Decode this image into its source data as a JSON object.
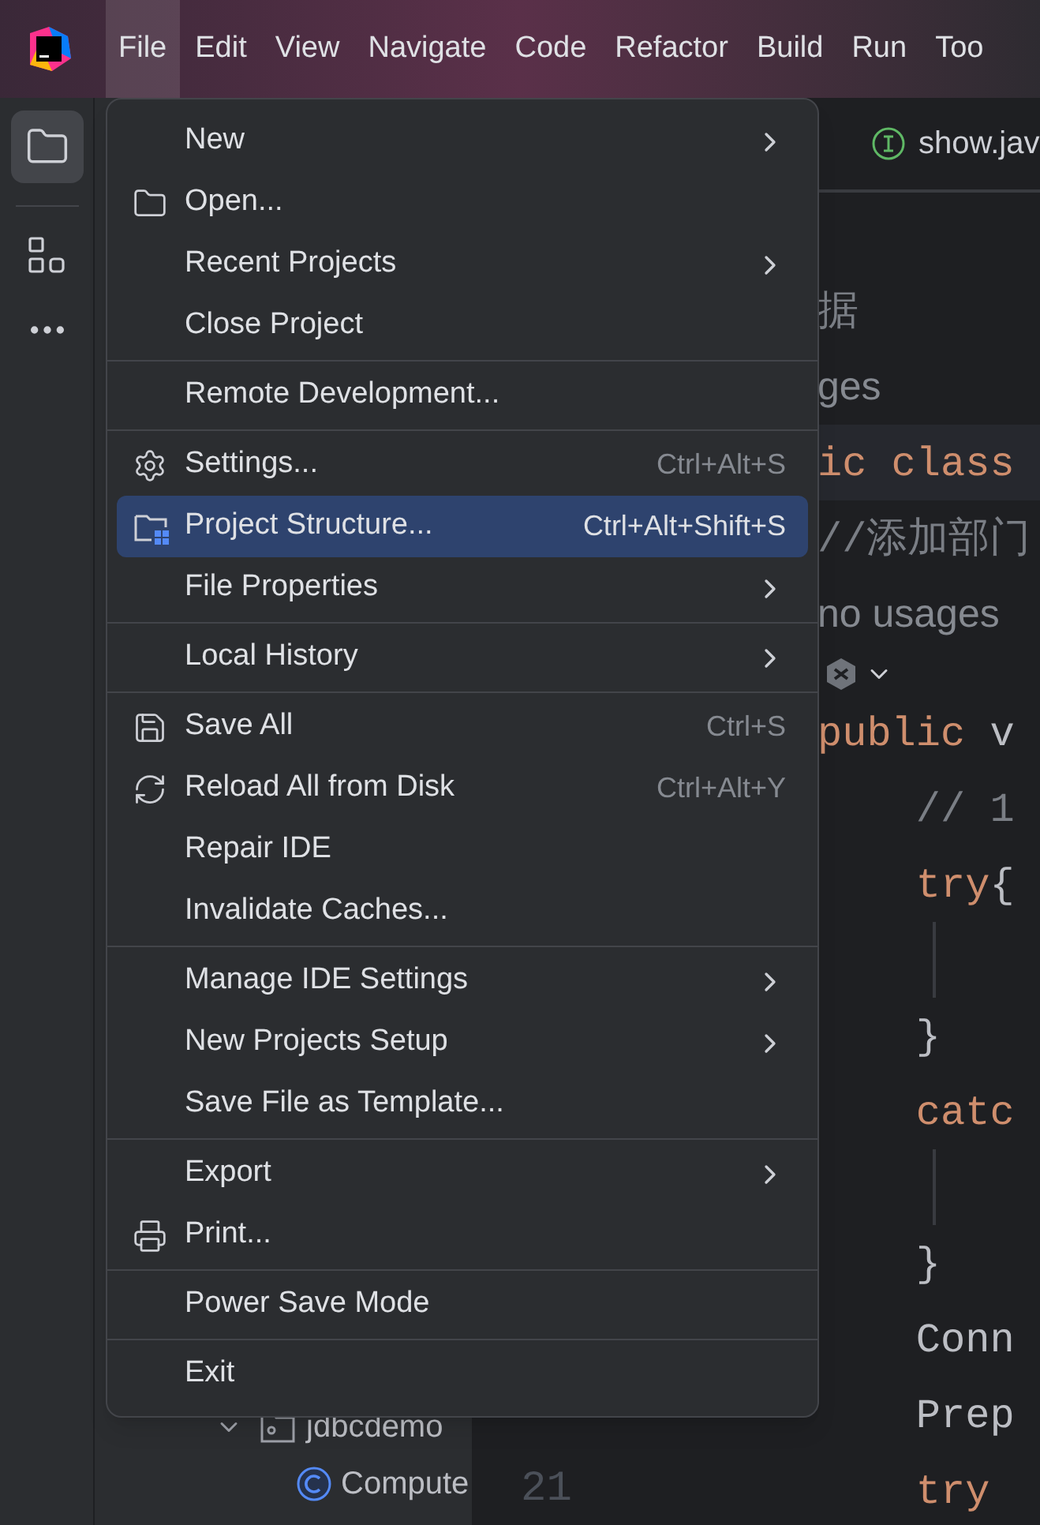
{
  "menubar": [
    {
      "label": "File",
      "selected": true
    },
    {
      "label": "Edit",
      "selected": false
    },
    {
      "label": "View",
      "selected": false
    },
    {
      "label": "Navigate",
      "selected": false
    },
    {
      "label": "Code",
      "selected": false
    },
    {
      "label": "Refactor",
      "selected": false
    },
    {
      "label": "Build",
      "selected": false
    },
    {
      "label": "Run",
      "selected": false
    },
    {
      "label": "Too",
      "selected": false
    }
  ],
  "file_menu": {
    "sections": [
      [
        {
          "label": "New",
          "submenu": true,
          "selected": false
        },
        {
          "label": "Open...",
          "submenu": false,
          "selected": false
        },
        {
          "label": "Recent Projects",
          "submenu": true,
          "selected": false
        },
        {
          "label": "Close Project",
          "submenu": false,
          "selected": false
        }
      ],
      [
        {
          "label": "Remote Development...",
          "submenu": false,
          "selected": false
        }
      ],
      [
        {
          "label": "Settings...",
          "shortcut": "Ctrl+Alt+S",
          "submenu": false,
          "selected": false
        },
        {
          "label": "Project Structure...",
          "shortcut": "Ctrl+Alt+Shift+S",
          "submenu": false,
          "selected": true
        },
        {
          "label": "File Properties",
          "submenu": true,
          "selected": false
        }
      ],
      [
        {
          "label": "Local History",
          "submenu": true,
          "selected": false
        }
      ],
      [
        {
          "label": "Save All",
          "shortcut": "Ctrl+S",
          "submenu": false,
          "selected": false
        },
        {
          "label": "Reload All from Disk",
          "shortcut": "Ctrl+Alt+Y",
          "submenu": false,
          "selected": false
        },
        {
          "label": "Repair IDE",
          "submenu": false,
          "selected": false
        },
        {
          "label": "Invalidate Caches...",
          "submenu": false,
          "selected": false
        }
      ],
      [
        {
          "label": "Manage IDE Settings",
          "submenu": true,
          "selected": false
        },
        {
          "label": "New Projects Setup",
          "submenu": true,
          "selected": false
        },
        {
          "label": "Save File as Template...",
          "submenu": false,
          "selected": false
        }
      ],
      [
        {
          "label": "Export",
          "submenu": true,
          "selected": false
        },
        {
          "label": "Print...",
          "submenu": false,
          "selected": false
        }
      ],
      [
        {
          "label": "Power Save Mode",
          "submenu": false,
          "selected": false
        }
      ],
      [
        {
          "label": "Exit",
          "submenu": false,
          "selected": false
        }
      ]
    ]
  },
  "editor": {
    "tab": {
      "label": "show.jav"
    },
    "rows": [
      {
        "segments": [
          {
            "kind": "comment",
            "text": "据"
          }
        ]
      },
      {
        "segments": [
          {
            "kind": "hint",
            "text": "ges"
          }
        ]
      },
      {
        "current": true,
        "segments": [
          {
            "kind": "keyword",
            "text": "ic class"
          }
        ]
      },
      {
        "segments": [
          {
            "kind": "comment",
            "text": "//添加部门"
          }
        ]
      },
      {
        "segments": [
          {
            "kind": "hint",
            "text": "no usages"
          }
        ]
      },
      {
        "kind": "inlay"
      },
      {
        "segments": [
          {
            "kind": "keyword",
            "text": "public"
          },
          {
            "kind": "plain",
            "text": " v"
          }
        ]
      },
      {
        "segments": [
          {
            "kind": "comment",
            "text": "    // 1"
          }
        ]
      },
      {
        "segments": [
          {
            "kind": "keyword",
            "text": "    try"
          },
          {
            "kind": "plain",
            "text": "{"
          }
        ]
      },
      {
        "guide": true
      },
      {
        "segments": [
          {
            "kind": "plain",
            "text": "    }"
          }
        ]
      },
      {
        "segments": [
          {
            "kind": "keyword",
            "text": "    catc"
          }
        ]
      },
      {
        "guide": true
      },
      {
        "segments": [
          {
            "kind": "plain",
            "text": "    }"
          }
        ]
      },
      {
        "segments": [
          {
            "kind": "plain",
            "text": "    Conn"
          }
        ]
      },
      {
        "segments": [
          {
            "kind": "plain",
            "text": "    Prep"
          }
        ]
      },
      {
        "number": "21",
        "segments": [
          {
            "kind": "keyword",
            "text": "    try"
          }
        ]
      }
    ]
  },
  "project_tree": [
    {
      "label": "jdbcdemo",
      "expanded": true,
      "children": [
        {
          "label": "Compute"
        }
      ]
    }
  ]
}
